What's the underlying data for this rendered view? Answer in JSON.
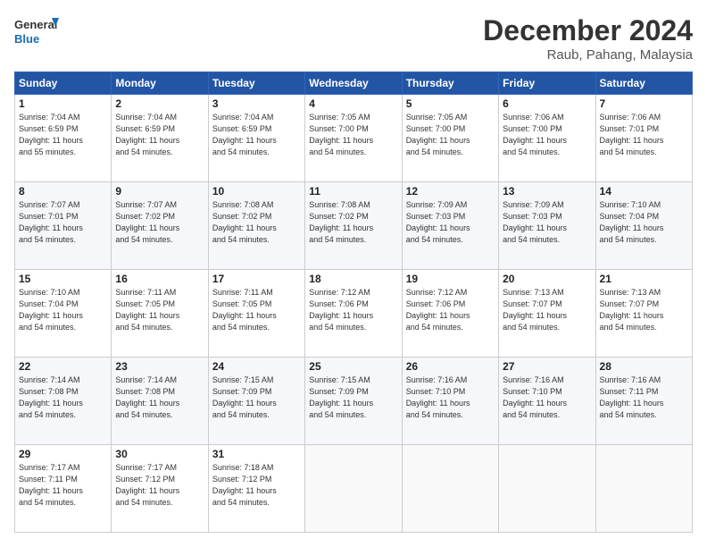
{
  "logo": {
    "line1": "General",
    "line2": "Blue"
  },
  "title": "December 2024",
  "subtitle": "Raub, Pahang, Malaysia",
  "weekdays": [
    "Sunday",
    "Monday",
    "Tuesday",
    "Wednesday",
    "Thursday",
    "Friday",
    "Saturday"
  ],
  "weeks": [
    [
      {
        "day": "1",
        "info": "Sunrise: 7:04 AM\nSunset: 6:59 PM\nDaylight: 11 hours\nand 55 minutes."
      },
      {
        "day": "2",
        "info": "Sunrise: 7:04 AM\nSunset: 6:59 PM\nDaylight: 11 hours\nand 54 minutes."
      },
      {
        "day": "3",
        "info": "Sunrise: 7:04 AM\nSunset: 6:59 PM\nDaylight: 11 hours\nand 54 minutes."
      },
      {
        "day": "4",
        "info": "Sunrise: 7:05 AM\nSunset: 7:00 PM\nDaylight: 11 hours\nand 54 minutes."
      },
      {
        "day": "5",
        "info": "Sunrise: 7:05 AM\nSunset: 7:00 PM\nDaylight: 11 hours\nand 54 minutes."
      },
      {
        "day": "6",
        "info": "Sunrise: 7:06 AM\nSunset: 7:00 PM\nDaylight: 11 hours\nand 54 minutes."
      },
      {
        "day": "7",
        "info": "Sunrise: 7:06 AM\nSunset: 7:01 PM\nDaylight: 11 hours\nand 54 minutes."
      }
    ],
    [
      {
        "day": "8",
        "info": "Sunrise: 7:07 AM\nSunset: 7:01 PM\nDaylight: 11 hours\nand 54 minutes."
      },
      {
        "day": "9",
        "info": "Sunrise: 7:07 AM\nSunset: 7:02 PM\nDaylight: 11 hours\nand 54 minutes."
      },
      {
        "day": "10",
        "info": "Sunrise: 7:08 AM\nSunset: 7:02 PM\nDaylight: 11 hours\nand 54 minutes."
      },
      {
        "day": "11",
        "info": "Sunrise: 7:08 AM\nSunset: 7:02 PM\nDaylight: 11 hours\nand 54 minutes."
      },
      {
        "day": "12",
        "info": "Sunrise: 7:09 AM\nSunset: 7:03 PM\nDaylight: 11 hours\nand 54 minutes."
      },
      {
        "day": "13",
        "info": "Sunrise: 7:09 AM\nSunset: 7:03 PM\nDaylight: 11 hours\nand 54 minutes."
      },
      {
        "day": "14",
        "info": "Sunrise: 7:10 AM\nSunset: 7:04 PM\nDaylight: 11 hours\nand 54 minutes."
      }
    ],
    [
      {
        "day": "15",
        "info": "Sunrise: 7:10 AM\nSunset: 7:04 PM\nDaylight: 11 hours\nand 54 minutes."
      },
      {
        "day": "16",
        "info": "Sunrise: 7:11 AM\nSunset: 7:05 PM\nDaylight: 11 hours\nand 54 minutes."
      },
      {
        "day": "17",
        "info": "Sunrise: 7:11 AM\nSunset: 7:05 PM\nDaylight: 11 hours\nand 54 minutes."
      },
      {
        "day": "18",
        "info": "Sunrise: 7:12 AM\nSunset: 7:06 PM\nDaylight: 11 hours\nand 54 minutes."
      },
      {
        "day": "19",
        "info": "Sunrise: 7:12 AM\nSunset: 7:06 PM\nDaylight: 11 hours\nand 54 minutes."
      },
      {
        "day": "20",
        "info": "Sunrise: 7:13 AM\nSunset: 7:07 PM\nDaylight: 11 hours\nand 54 minutes."
      },
      {
        "day": "21",
        "info": "Sunrise: 7:13 AM\nSunset: 7:07 PM\nDaylight: 11 hours\nand 54 minutes."
      }
    ],
    [
      {
        "day": "22",
        "info": "Sunrise: 7:14 AM\nSunset: 7:08 PM\nDaylight: 11 hours\nand 54 minutes."
      },
      {
        "day": "23",
        "info": "Sunrise: 7:14 AM\nSunset: 7:08 PM\nDaylight: 11 hours\nand 54 minutes."
      },
      {
        "day": "24",
        "info": "Sunrise: 7:15 AM\nSunset: 7:09 PM\nDaylight: 11 hours\nand 54 minutes."
      },
      {
        "day": "25",
        "info": "Sunrise: 7:15 AM\nSunset: 7:09 PM\nDaylight: 11 hours\nand 54 minutes."
      },
      {
        "day": "26",
        "info": "Sunrise: 7:16 AM\nSunset: 7:10 PM\nDaylight: 11 hours\nand 54 minutes."
      },
      {
        "day": "27",
        "info": "Sunrise: 7:16 AM\nSunset: 7:10 PM\nDaylight: 11 hours\nand 54 minutes."
      },
      {
        "day": "28",
        "info": "Sunrise: 7:16 AM\nSunset: 7:11 PM\nDaylight: 11 hours\nand 54 minutes."
      }
    ],
    [
      {
        "day": "29",
        "info": "Sunrise: 7:17 AM\nSunset: 7:11 PM\nDaylight: 11 hours\nand 54 minutes."
      },
      {
        "day": "30",
        "info": "Sunrise: 7:17 AM\nSunset: 7:12 PM\nDaylight: 11 hours\nand 54 minutes."
      },
      {
        "day": "31",
        "info": "Sunrise: 7:18 AM\nSunset: 7:12 PM\nDaylight: 11 hours\nand 54 minutes."
      },
      null,
      null,
      null,
      null
    ]
  ]
}
